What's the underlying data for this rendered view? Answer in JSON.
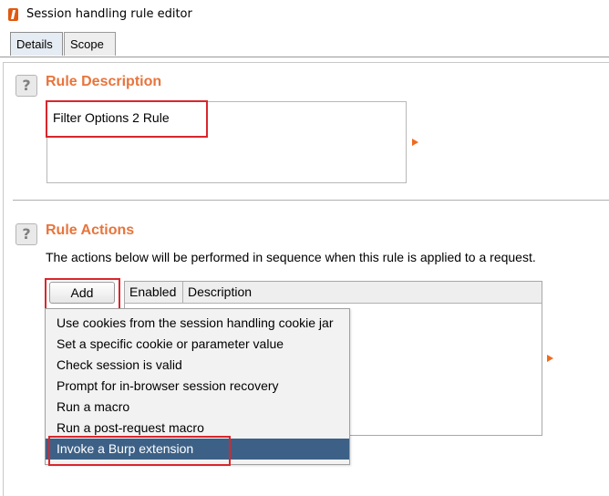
{
  "window": {
    "title": "Session handling rule editor"
  },
  "tabs": [
    {
      "label": "Details",
      "active": true
    },
    {
      "label": "Scope",
      "active": false
    }
  ],
  "rule_description": {
    "heading": "Rule Description",
    "help_glyph": "?",
    "value": "Filter Options 2 Rule"
  },
  "rule_actions": {
    "heading": "Rule Actions",
    "help_glyph": "?",
    "subtext": "The actions below will be performed in sequence when this rule is applied to a request.",
    "add_label": "Add",
    "columns": [
      "Enabled",
      "Description"
    ]
  },
  "add_menu": {
    "items": [
      "Use cookies from the session handling cookie jar",
      "Set a specific cookie or parameter value",
      "Check session is valid",
      "Prompt for in-browser session recovery",
      "Run a macro",
      "Run a post-request macro",
      "Invoke a Burp extension"
    ],
    "selected": "Invoke a Burp extension"
  },
  "colors": {
    "heading": "#e8743b",
    "highlight_box": "#d9262c",
    "menu_selected": "#3d6186",
    "arrow": "#f06a1e"
  },
  "icons": [
    "burp-app-icon",
    "help-icon",
    "expand-arrow-icon"
  ]
}
